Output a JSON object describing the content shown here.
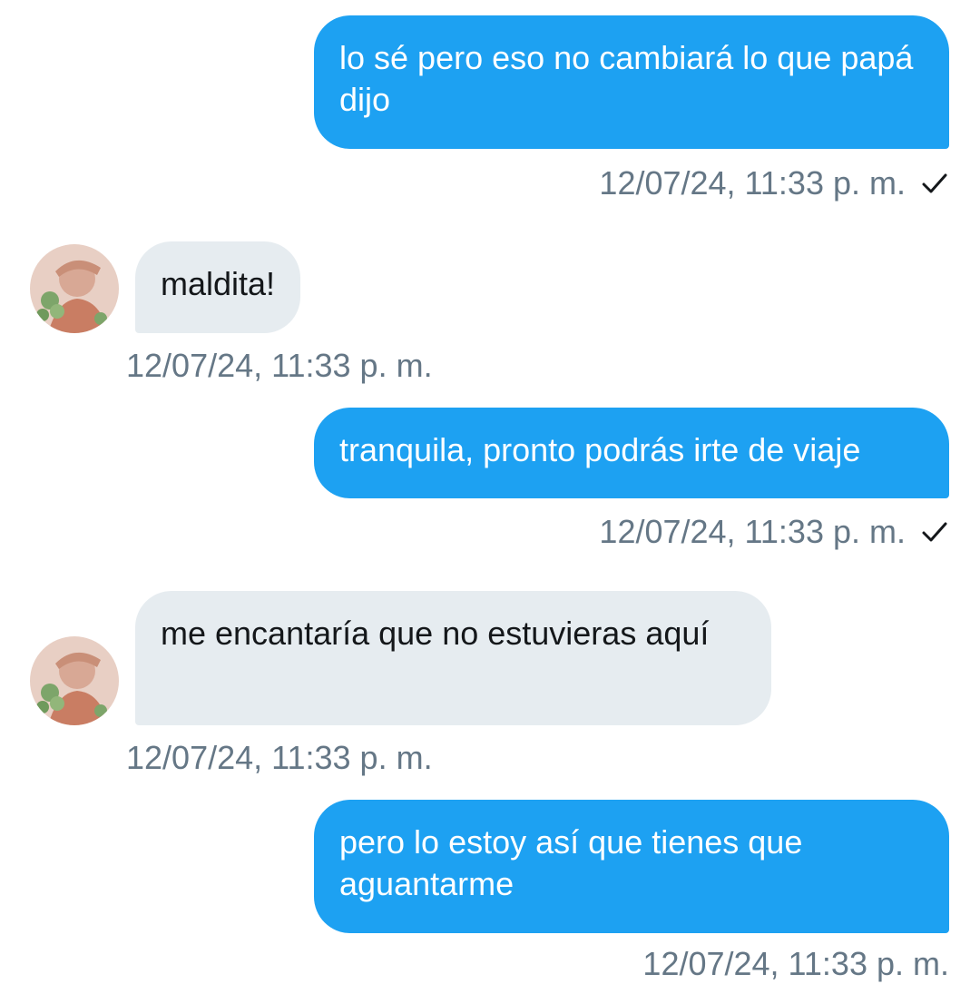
{
  "conversation": {
    "messages": [
      {
        "direction": "outgoing",
        "text": "lo sé pero eso no cambiará lo que papá dijo",
        "timestamp": "12/07/24, 11:33 p. m.",
        "status_icon": "check-icon"
      },
      {
        "direction": "incoming",
        "text": "maldita!",
        "timestamp": "12/07/24, 11:33 p. m.",
        "avatar": "contact-avatar"
      },
      {
        "direction": "outgoing",
        "text": "tranquila, pronto podrás irte de viaje",
        "timestamp": "12/07/24, 11:33 p. m.",
        "status_icon": "check-icon"
      },
      {
        "direction": "incoming",
        "text": "me encantaría que no estuvieras aquí",
        "timestamp": "12/07/24, 11:33 p. m.",
        "avatar": "contact-avatar"
      },
      {
        "direction": "outgoing",
        "text": "pero lo estoy así que tienes que aguantarme",
        "timestamp": "12/07/24, 11:33 p. m.",
        "status_icon": "check-icon"
      }
    ]
  },
  "colors": {
    "outgoing_bubble": "#1da1f2",
    "incoming_bubble": "#e6ecf0",
    "timestamp_text": "#657786"
  }
}
